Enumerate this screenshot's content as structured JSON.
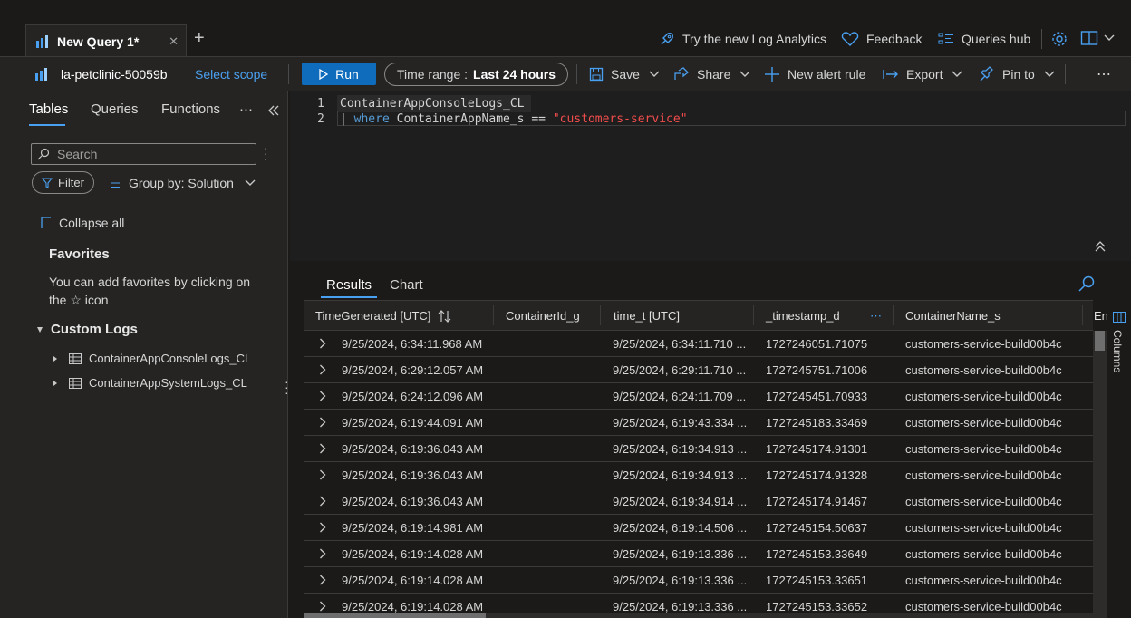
{
  "tabs": [
    {
      "label": "New Query 1*"
    }
  ],
  "top_actions": {
    "try_new": "Try the new Log Analytics",
    "feedback": "Feedback",
    "queries_hub": "Queries hub"
  },
  "toolbar": {
    "workspace": "la-petclinic-50059b",
    "select_scope": "Select scope",
    "run": "Run",
    "time_range_label": "Time range :",
    "time_range_value": "Last 24 hours",
    "save": "Save",
    "share": "Share",
    "new_alert_rule": "New alert rule",
    "export": "Export",
    "pin_to": "Pin to",
    "more": "⋯"
  },
  "left_panel": {
    "tabs": [
      "Tables",
      "Queries",
      "Functions"
    ],
    "more": "⋯",
    "search_placeholder": "Search",
    "filter": "Filter",
    "group_by": "Group by: Solution",
    "collapse_all": "Collapse all",
    "favorites_title": "Favorites",
    "favorites_hint_line1": "You can add favorites by clicking on",
    "favorites_hint_line2": "the ☆ icon",
    "custom_logs": "Custom Logs",
    "tables": [
      "ContainerAppConsoleLogs_CL",
      "ContainerAppSystemLogs_CL"
    ]
  },
  "editor": {
    "line_numbers": [
      "1",
      "2"
    ],
    "line1": "ContainerAppConsoleLogs_CL",
    "line2_pipe": "| ",
    "line2_kw": "where",
    "line2_mid": " ContainerAppName_s == ",
    "line2_str": "\"customers-service\""
  },
  "results": {
    "tabs": [
      "Results",
      "Chart"
    ],
    "columns": [
      "TimeGenerated [UTC]",
      "ContainerId_g",
      "time_t [UTC]",
      "_timestamp_d",
      "ContainerName_s",
      "En"
    ],
    "rows": [
      [
        "9/25/2024, 6:34:11.968 AM",
        "",
        "9/25/2024, 6:34:11.710 ...",
        "1727246051.71075",
        "customers-service-build00b4c"
      ],
      [
        "9/25/2024, 6:29:12.057 AM",
        "",
        "9/25/2024, 6:29:11.710 ...",
        "1727245751.71006",
        "customers-service-build00b4c"
      ],
      [
        "9/25/2024, 6:24:12.096 AM",
        "",
        "9/25/2024, 6:24:11.709 ...",
        "1727245451.70933",
        "customers-service-build00b4c"
      ],
      [
        "9/25/2024, 6:19:44.091 AM",
        "",
        "9/25/2024, 6:19:43.334 ...",
        "1727245183.33469",
        "customers-service-build00b4c"
      ],
      [
        "9/25/2024, 6:19:36.043 AM",
        "",
        "9/25/2024, 6:19:34.913 ...",
        "1727245174.91301",
        "customers-service-build00b4c"
      ],
      [
        "9/25/2024, 6:19:36.043 AM",
        "",
        "9/25/2024, 6:19:34.913 ...",
        "1727245174.91328",
        "customers-service-build00b4c"
      ],
      [
        "9/25/2024, 6:19:36.043 AM",
        "",
        "9/25/2024, 6:19:34.914 ...",
        "1727245174.91467",
        "customers-service-build00b4c"
      ],
      [
        "9/25/2024, 6:19:14.981 AM",
        "",
        "9/25/2024, 6:19:14.506 ...",
        "1727245154.50637",
        "customers-service-build00b4c"
      ],
      [
        "9/25/2024, 6:19:14.028 AM",
        "",
        "9/25/2024, 6:19:13.336 ...",
        "1727245153.33649",
        "customers-service-build00b4c"
      ],
      [
        "9/25/2024, 6:19:14.028 AM",
        "",
        "9/25/2024, 6:19:13.336 ...",
        "1727245153.33651",
        "customers-service-build00b4c"
      ],
      [
        "9/25/2024, 6:19:14.028 AM",
        "",
        "9/25/2024, 6:19:13.336 ...",
        "1727245153.33652",
        "customers-service-build00b4c"
      ]
    ],
    "columns_side_label": "Columns"
  },
  "colors": {
    "accent": "#0f6cbd",
    "keyword": "#569cd6",
    "string": "#f14c4c"
  }
}
